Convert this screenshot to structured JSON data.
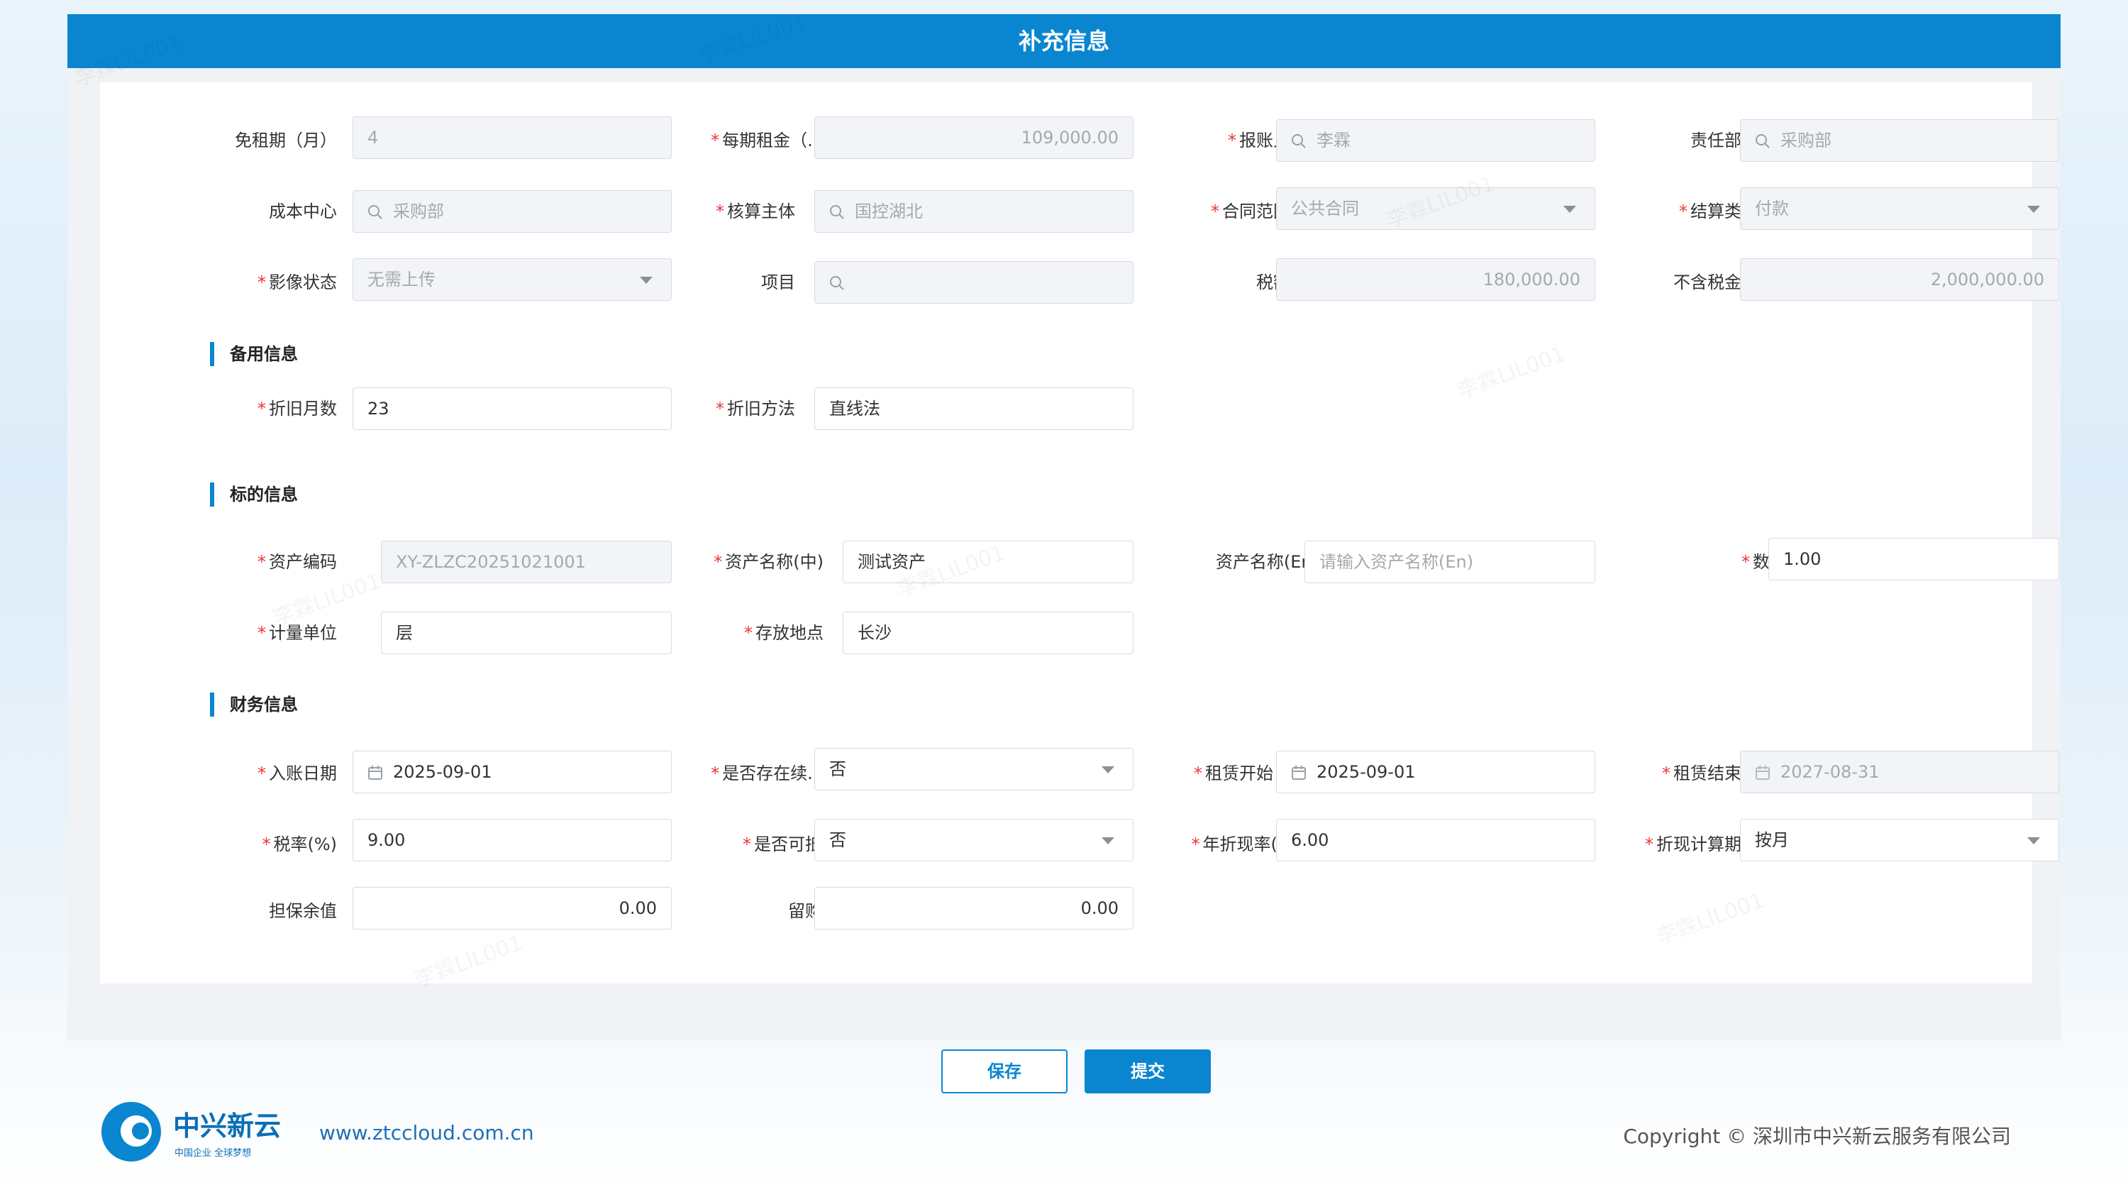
{
  "dialog": {
    "title": "补充信息"
  },
  "basic": {
    "rent_free_label": "免租期（月）",
    "rent_free_value": "4",
    "rent_per_label": "每期租金（...",
    "rent_per_value": "109,000.00",
    "reporter_label": "报账人",
    "reporter_value": "李霖",
    "dept_label": "责任部门",
    "dept_value": "采购部",
    "cost_center_label": "成本中心",
    "cost_center_value": "采购部",
    "accounting_label": "核算主体",
    "accounting_value": "国控湖北",
    "contract_scope_label": "合同范围",
    "contract_scope_value": "公共合同",
    "settle_type_label": "结算类型",
    "settle_type_value": "付款",
    "image_status_label": "影像状态",
    "image_status_value": "无需上传",
    "project_label": "项目",
    "project_value": "",
    "tax_label": "税额",
    "tax_value": "180,000.00",
    "excl_tax_label": "不含税金额",
    "excl_tax_value": "2,000,000.00"
  },
  "backup": {
    "title": "备用信息",
    "depr_months_label": "折旧月数",
    "depr_months_value": "23",
    "depr_method_label": "折旧方法",
    "depr_method_value": "直线法"
  },
  "target": {
    "title": "标的信息",
    "asset_code_label": "资产编码",
    "asset_code_value": "XY-ZLZC20251021001",
    "asset_name_cn_label": "资产名称(中)",
    "asset_name_cn_value": "测试资产",
    "asset_name_en_label": "资产名称(En)",
    "asset_name_en_placeholder": "请输入资产名称(En)",
    "qty_label": "数量",
    "qty_value": "1.00",
    "unit_label": "计量单位",
    "unit_value": "层",
    "location_label": "存放地点",
    "location_value": "长沙"
  },
  "finance": {
    "title": "财务信息",
    "entry_date_label": "入账日期",
    "entry_date_value": "2025-09-01",
    "continue_label": "是否存在续...",
    "continue_value": "否",
    "lease_start_label": "租赁开始日",
    "lease_start_value": "2025-09-01",
    "lease_end_label": "租赁结束日",
    "lease_end_value": "2027-08-31",
    "tax_rate_label": "税率(%)",
    "tax_rate_value": "9.00",
    "deductible_label": "是否可抵扣",
    "deductible_value": "否",
    "discount_rate_label": "年折现率(%)",
    "discount_rate_value": "6.00",
    "discount_period_label": "折现计算期间",
    "discount_period_value": "按月",
    "residual_label": "担保余值",
    "residual_value": "0.00",
    "buyback_label": "留购价",
    "buyback_value": "0.00"
  },
  "buttons": {
    "save": "保存",
    "submit": "提交"
  },
  "footer": {
    "logo_text": "中兴新云",
    "logo_sub": "中国企业 全球梦想",
    "url": "www.ztccloud.com.cn",
    "copyright": "Copyright © 深圳市中兴新云服务有限公司"
  },
  "watermark": "李霖LIL001",
  "colors": {
    "primary": "#0a86d1",
    "required": "#e33333"
  }
}
